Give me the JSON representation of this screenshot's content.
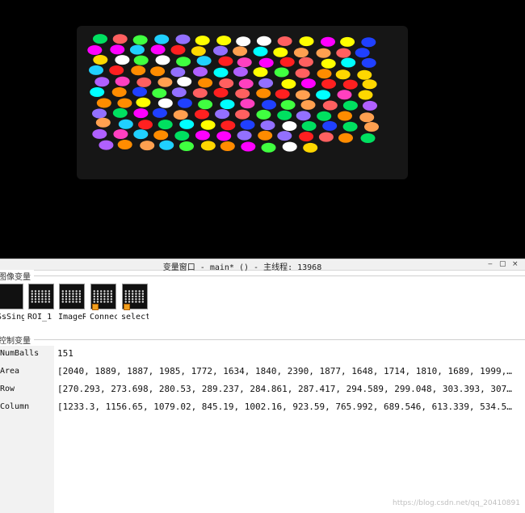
{
  "window": {
    "title": "变量窗口 - main* () - 主线程: 13968",
    "minimize_glyph": "‒",
    "maximize_glyph": "▢",
    "close_glyph": "×"
  },
  "image_section": {
    "header": "图像变量",
    "items": [
      {
        "label": "SsSing",
        "icon": "image-thumbnail-icon",
        "locked": false
      },
      {
        "label": "ROI_1",
        "icon": "image-thumbnail-icon",
        "locked": false
      },
      {
        "label": "ImageR",
        "icon": "image-thumbnail-icon",
        "locked": false
      },
      {
        "label": "Connec",
        "icon": "region-thumbnail-icon",
        "locked": true
      },
      {
        "label": "select",
        "icon": "region-thumbnail-icon",
        "locked": true
      }
    ]
  },
  "control_section": {
    "header": "控制变量",
    "rows": [
      {
        "name": "NumBalls",
        "value": "151"
      },
      {
        "name": "Area",
        "value": "[2040, 1889, 1887, 1985, 1772, 1634, 1840, 2390, 1877, 1648, 1714, 1810, 1689, 1999,…"
      },
      {
        "name": "Row",
        "value": "[270.293, 273.698, 280.53, 289.237, 284.861, 287.417, 294.589, 299.048, 303.393, 307…"
      },
      {
        "name": "Column",
        "value": "[1233.3, 1156.65, 1079.02, 845.19, 1002.16, 923.59, 765.992, 689.546, 613.339, 534.5…"
      }
    ]
  },
  "watermark": "https://blog.csdn.net/qq_20410891",
  "palette": [
    "#ff2020",
    "#00e060",
    "#ffff00",
    "#ff00ff",
    "#00ffff",
    "#2040ff",
    "#ff8c00",
    "#9370ff",
    "#ff6060",
    "#40ff40",
    "#ffd700",
    "#ff40c0",
    "#20d0ff",
    "#ffa050",
    "#b060ff",
    "#ffffff"
  ]
}
